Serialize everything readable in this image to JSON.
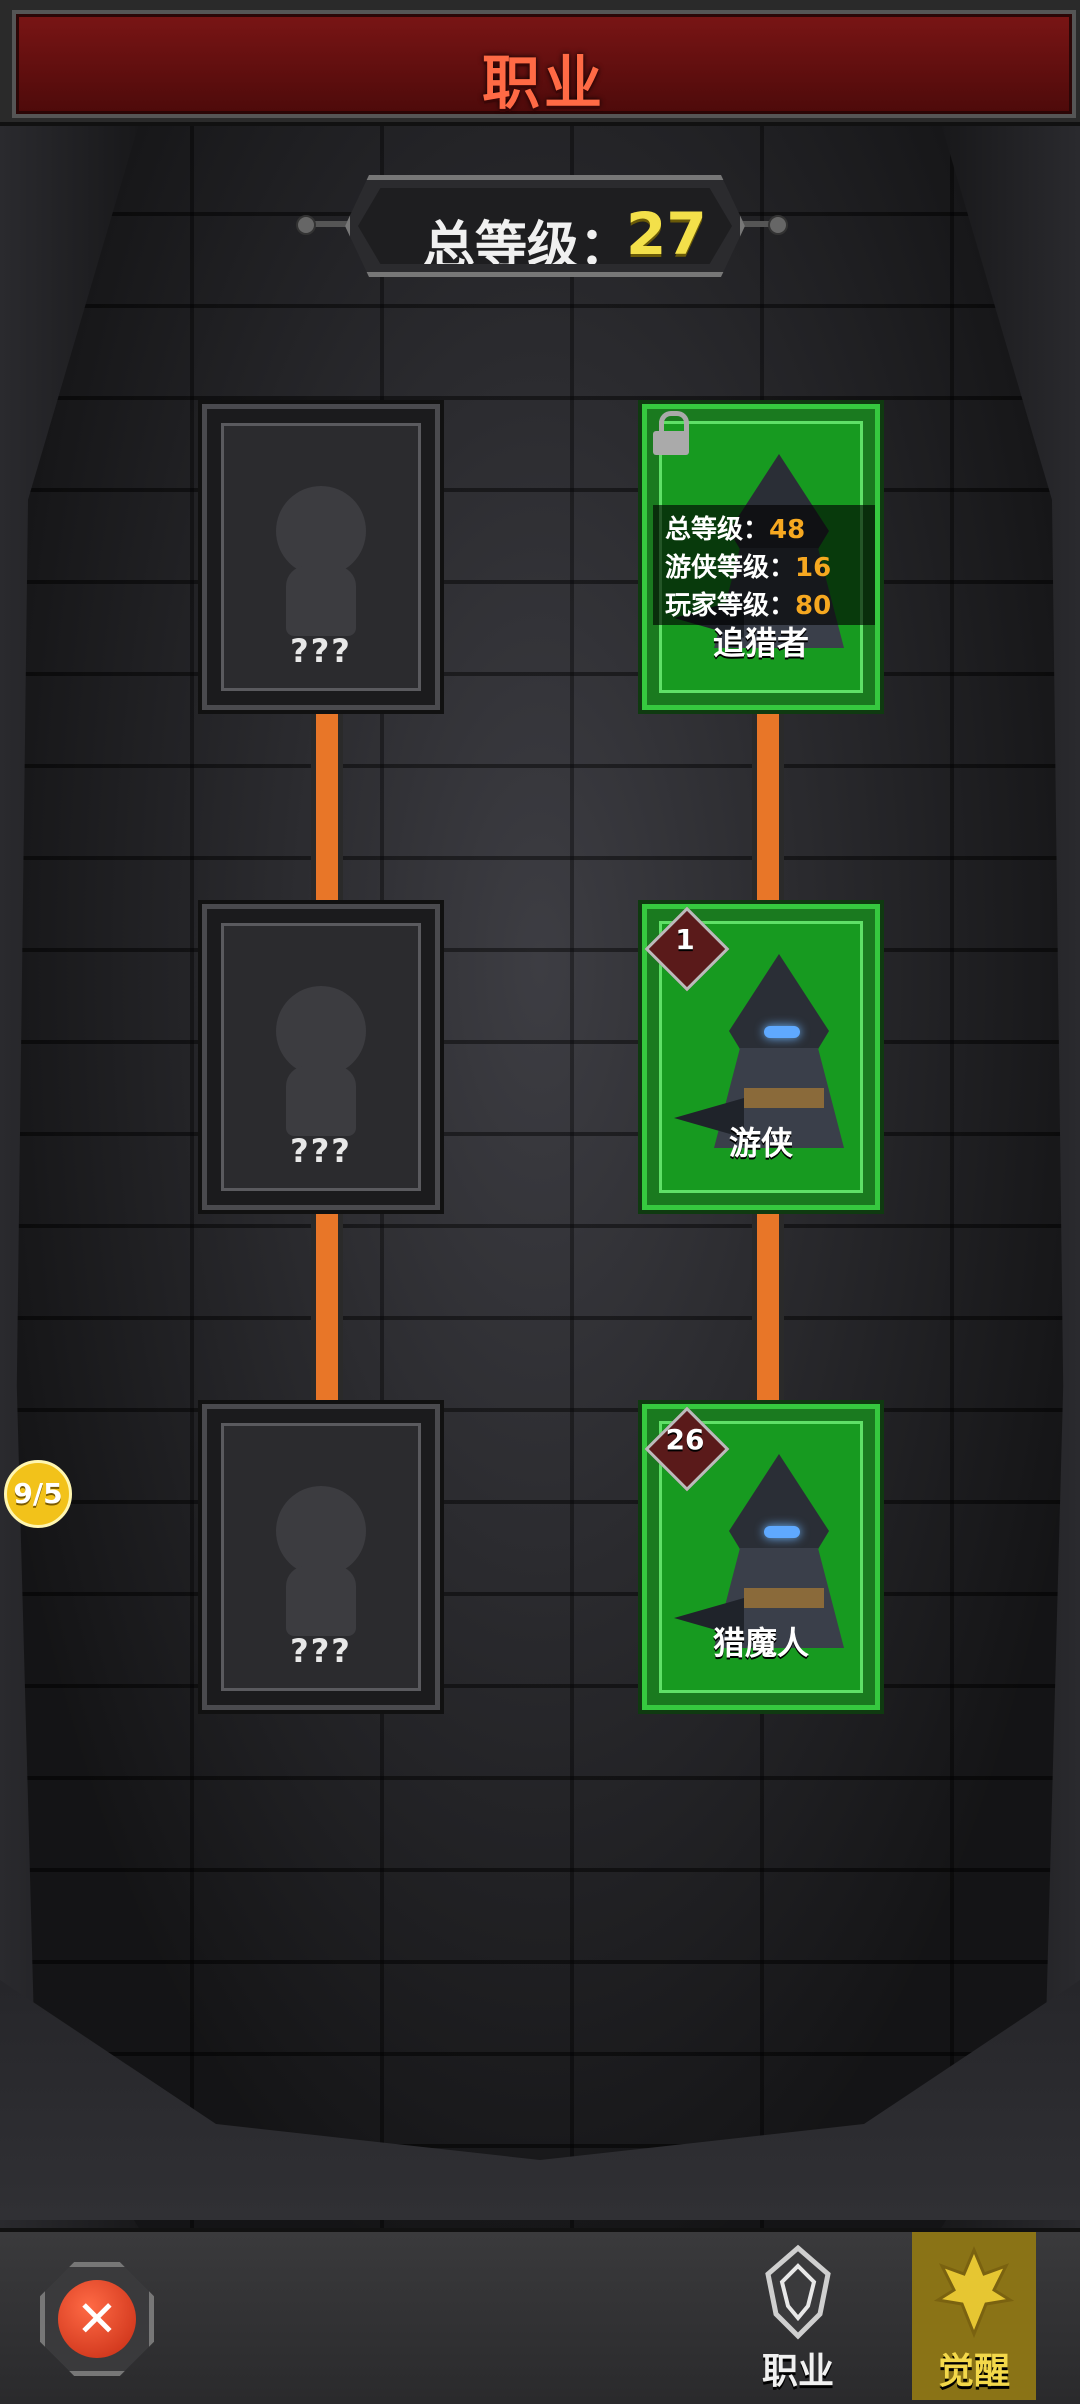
{
  "header": {
    "title": "职业"
  },
  "total_level": {
    "label": "总等级：",
    "value": "27"
  },
  "left_column": [
    {
      "name": "???",
      "locked": true
    },
    {
      "name": "???",
      "locked": true
    },
    {
      "name": "???",
      "locked": true
    }
  ],
  "right_column": {
    "top": {
      "name": "追猎者",
      "locked": true,
      "requirements": [
        {
          "label": "总等级：",
          "value": "48"
        },
        {
          "label": "游侠等级：",
          "value": "16"
        },
        {
          "label": "玩家等级：",
          "value": "80"
        }
      ]
    },
    "middle": {
      "name": "游侠",
      "level": "1"
    },
    "bottom": {
      "name": "猎魔人",
      "level": "26"
    }
  },
  "side_badge": {
    "text": "9/5"
  },
  "bottom_nav": {
    "close_icon": "close-icon",
    "tabs": [
      {
        "label": "职业",
        "icon": "class-emblem-icon",
        "active": false
      },
      {
        "label": "觉醒",
        "icon": "awaken-emblem-icon",
        "active": true
      }
    ]
  },
  "colors": {
    "header_red": "#7a1515",
    "title_orange": "#ff6a45",
    "level_yellow": "#f3e04a",
    "card_green": "#1a7a1f",
    "connector_orange": "#e87628",
    "requirement_value": "#f6a820",
    "active_tab": "#8a7316"
  }
}
